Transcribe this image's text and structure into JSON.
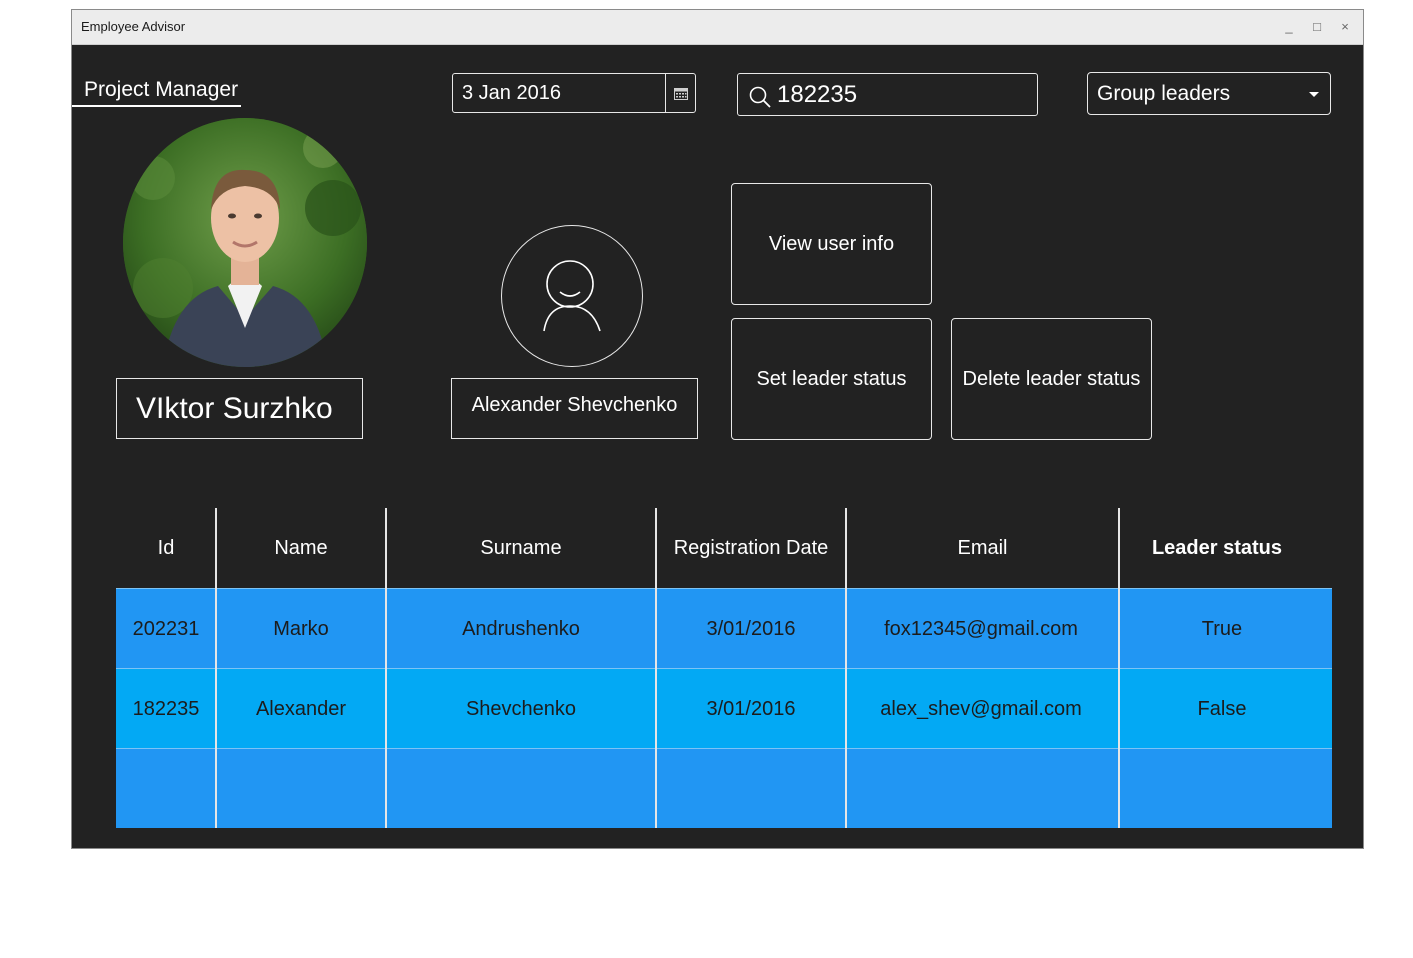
{
  "window": {
    "title": "Employee Advisor",
    "controls": {
      "minimize": "_",
      "maximize": "□",
      "close": "×"
    }
  },
  "header": {
    "role_label": "Project Manager",
    "date_value": "3 Jan 2016",
    "search_value": "182235",
    "group_select": "Group leaders"
  },
  "profile": {
    "name": "VIktor Surzhko"
  },
  "selected_user": {
    "name": "Alexander Shevchenko"
  },
  "actions": {
    "view": "View user info",
    "set_leader": "Set leader status",
    "delete_leader": "Delete leader status"
  },
  "table": {
    "columns": [
      "Id",
      "Name",
      "Surname",
      "Registration Date",
      "Email",
      "Leader status"
    ],
    "rows": [
      [
        "202231",
        "Marko",
        "Andrushenko",
        "3/01/2016",
        "fox12345@gmail.com",
        "True"
      ],
      [
        "182235",
        "Alexander",
        "Shevchenko",
        "3/01/2016",
        "alex_shev@gmail.com",
        "False"
      ],
      [
        "",
        "",
        "",
        "",
        "",
        ""
      ]
    ]
  },
  "colors": {
    "background": "#222222",
    "row_blue": "#2196f3",
    "row_selected": "#03a9f4"
  }
}
